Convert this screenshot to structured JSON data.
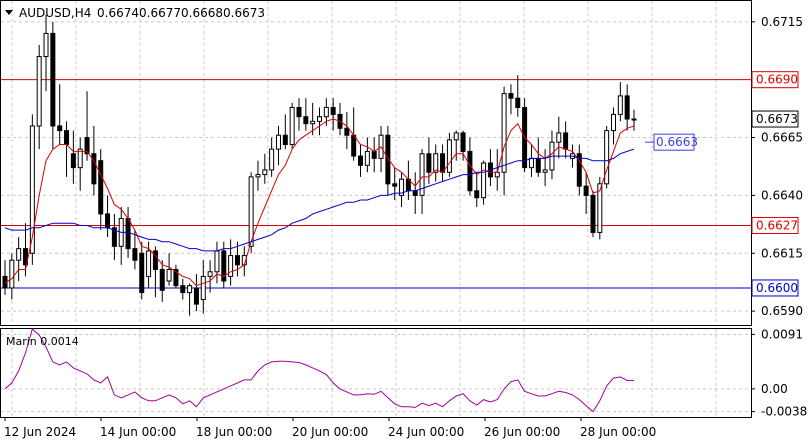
{
  "chart_data": {
    "type": "candlestick",
    "symbol_header": "AUDUSD,H4",
    "ohlc_header": [
      "0.6674",
      "0.6677",
      "0.6668",
      "0.6673"
    ],
    "x_tick_labels": [
      "12 Jun 2024",
      "14 Jun 00:00",
      "18 Jun 00:00",
      "20 Jun 00:00",
      "24 Jun 00:00",
      "26 Jun 00:00",
      "28 Jun 00:00"
    ],
    "price_ticks": [
      "0.6715",
      "0.6665",
      "0.6640",
      "0.6615",
      "0.6590"
    ],
    "price_ylim": [
      0.6584,
      0.6724
    ],
    "grid": true,
    "series": [
      {
        "name": "",
        "kind": "ohlc",
        "ohlc": [
          [
            0.6605,
            0.6612,
            0.6597,
            0.66
          ],
          [
            0.66,
            0.6615,
            0.6595,
            0.6612
          ],
          [
            0.6612,
            0.6622,
            0.6603,
            0.6617
          ],
          [
            0.6617,
            0.6628,
            0.6605,
            0.661
          ],
          [
            0.6615,
            0.6675,
            0.661,
            0.667
          ],
          [
            0.667,
            0.6705,
            0.666,
            0.67
          ],
          [
            0.67,
            0.6718,
            0.6685,
            0.671
          ],
          [
            0.671,
            0.6715,
            0.666,
            0.667
          ],
          [
            0.667,
            0.6688,
            0.6662,
            0.6668
          ],
          [
            0.6668,
            0.6672,
            0.6648,
            0.6662
          ],
          [
            0.6658,
            0.6668,
            0.6645,
            0.6652
          ],
          [
            0.6652,
            0.6665,
            0.6642,
            0.666
          ],
          [
            0.6665,
            0.6685,
            0.6655,
            0.6658
          ],
          [
            0.6658,
            0.667,
            0.664,
            0.6645
          ],
          [
            0.6655,
            0.666,
            0.6625,
            0.6632
          ],
          [
            0.6632,
            0.664,
            0.6622,
            0.6626
          ],
          [
            0.6626,
            0.6632,
            0.6612,
            0.6618
          ],
          [
            0.6618,
            0.6635,
            0.661,
            0.663
          ],
          [
            0.663,
            0.6635,
            0.6613,
            0.6617
          ],
          [
            0.6617,
            0.6625,
            0.6608,
            0.6612
          ],
          [
            0.6615,
            0.662,
            0.6595,
            0.6598
          ],
          [
            0.6605,
            0.662,
            0.66,
            0.6616
          ],
          [
            0.6616,
            0.6618,
            0.6596,
            0.6608
          ],
          [
            0.6608,
            0.6612,
            0.6594,
            0.6599
          ],
          [
            0.6603,
            0.6615,
            0.6601,
            0.6608
          ],
          [
            0.6608,
            0.661,
            0.66,
            0.6601
          ],
          [
            0.6601,
            0.6604,
            0.6595,
            0.6598
          ],
          [
            0.6598,
            0.6602,
            0.6588,
            0.6601
          ],
          [
            0.66,
            0.6606,
            0.659,
            0.6593
          ],
          [
            0.6595,
            0.6612,
            0.6589,
            0.6605
          ],
          [
            0.6605,
            0.6612,
            0.6598,
            0.6607
          ],
          [
            0.6607,
            0.662,
            0.6602,
            0.6616
          ],
          [
            0.6616,
            0.662,
            0.66,
            0.6603
          ],
          [
            0.6605,
            0.6621,
            0.6601,
            0.6614
          ],
          [
            0.6614,
            0.662,
            0.6605,
            0.661
          ],
          [
            0.661,
            0.6618,
            0.6605,
            0.6614
          ],
          [
            0.6618,
            0.665,
            0.6615,
            0.6648
          ],
          [
            0.6648,
            0.6655,
            0.6642,
            0.6649
          ],
          [
            0.6649,
            0.6658,
            0.6645,
            0.6651
          ],
          [
            0.6651,
            0.6665,
            0.6648,
            0.666
          ],
          [
            0.666,
            0.667,
            0.6653,
            0.6666
          ],
          [
            0.6666,
            0.6675,
            0.666,
            0.6662
          ],
          [
            0.6662,
            0.668,
            0.666,
            0.6678
          ],
          [
            0.6678,
            0.6682,
            0.6668,
            0.6674
          ],
          [
            0.6674,
            0.6682,
            0.6668,
            0.6671
          ],
          [
            0.6671,
            0.668,
            0.6666,
            0.6672
          ],
          [
            0.6672,
            0.6678,
            0.6666,
            0.6674
          ],
          [
            0.6674,
            0.6682,
            0.667,
            0.6678
          ],
          [
            0.6678,
            0.6682,
            0.6668,
            0.6675
          ],
          [
            0.6675,
            0.668,
            0.6666,
            0.6669
          ],
          [
            0.6669,
            0.6676,
            0.666,
            0.6666
          ],
          [
            0.6666,
            0.6678,
            0.6655,
            0.6657
          ],
          [
            0.6657,
            0.6662,
            0.6648,
            0.6653
          ],
          [
            0.6653,
            0.6665,
            0.665,
            0.6659
          ],
          [
            0.6659,
            0.6665,
            0.665,
            0.6656
          ],
          [
            0.6656,
            0.667,
            0.665,
            0.6666
          ],
          [
            0.6666,
            0.667,
            0.664,
            0.6645
          ],
          [
            0.6645,
            0.6652,
            0.6638,
            0.6644
          ],
          [
            0.664,
            0.665,
            0.6635,
            0.6647
          ],
          [
            0.6647,
            0.6655,
            0.6638,
            0.6642
          ],
          [
            0.6642,
            0.665,
            0.6632,
            0.664
          ],
          [
            0.664,
            0.666,
            0.6632,
            0.6658
          ],
          [
            0.6658,
            0.6665,
            0.6645,
            0.665
          ],
          [
            0.665,
            0.6662,
            0.6646,
            0.6658
          ],
          [
            0.6658,
            0.6662,
            0.6646,
            0.665
          ],
          [
            0.665,
            0.6667,
            0.6648,
            0.6664
          ],
          [
            0.6664,
            0.6668,
            0.6655,
            0.6667
          ],
          [
            0.6667,
            0.6668,
            0.6655,
            0.6659
          ],
          [
            0.6659,
            0.6665,
            0.664,
            0.6642
          ],
          [
            0.6642,
            0.665,
            0.6635,
            0.6639
          ],
          [
            0.6639,
            0.6655,
            0.6636,
            0.6654
          ],
          [
            0.6654,
            0.666,
            0.6644,
            0.6648
          ],
          [
            0.6648,
            0.666,
            0.6642,
            0.665
          ],
          [
            0.665,
            0.6687,
            0.664,
            0.6684
          ],
          [
            0.6684,
            0.6688,
            0.6675,
            0.6682
          ],
          [
            0.6682,
            0.6692,
            0.6674,
            0.6678
          ],
          [
            0.6678,
            0.6682,
            0.665,
            0.6652
          ],
          [
            0.6652,
            0.6662,
            0.6648,
            0.6656
          ],
          [
            0.6656,
            0.6665,
            0.6648,
            0.665
          ],
          [
            0.665,
            0.666,
            0.6644,
            0.6651
          ],
          [
            0.6651,
            0.6668,
            0.6647,
            0.6663
          ],
          [
            0.6663,
            0.6674,
            0.6656,
            0.6667
          ],
          [
            0.6667,
            0.6672,
            0.6656,
            0.666
          ],
          [
            0.6656,
            0.6662,
            0.6652,
            0.6658
          ],
          [
            0.6658,
            0.6662,
            0.664,
            0.6644
          ],
          [
            0.6644,
            0.665,
            0.6632,
            0.664
          ],
          [
            0.664,
            0.6642,
            0.6622,
            0.6624
          ],
          [
            0.6624,
            0.6648,
            0.6621,
            0.6645
          ],
          [
            0.6645,
            0.667,
            0.6643,
            0.6668
          ],
          [
            0.6668,
            0.6678,
            0.6662,
            0.6675
          ],
          [
            0.6675,
            0.6689,
            0.6672,
            0.6683
          ],
          [
            0.6683,
            0.6688,
            0.6668,
            0.6673
          ],
          [
            0.6673,
            0.6677,
            0.6668,
            0.6673
          ]
        ]
      },
      {
        "name": "",
        "kind": "line",
        "color": "#dc0000",
        "values": [
          0.6602,
          0.6604,
          0.6608,
          0.6608,
          0.6622,
          0.664,
          0.6655,
          0.666,
          0.6662,
          0.6662,
          0.6659,
          0.6659,
          0.6659,
          0.6655,
          0.6649,
          0.6643,
          0.6636,
          0.6634,
          0.663,
          0.6625,
          0.6618,
          0.6617,
          0.6614,
          0.661,
          0.6609,
          0.6607,
          0.6605,
          0.6604,
          0.6601,
          0.6602,
          0.6603,
          0.6606,
          0.6605,
          0.6607,
          0.6608,
          0.661,
          0.662,
          0.6628,
          0.6635,
          0.6642,
          0.6649,
          0.6653,
          0.666,
          0.6664,
          0.6666,
          0.6668,
          0.667,
          0.6672,
          0.6673,
          0.6672,
          0.667,
          0.6666,
          0.6662,
          0.6661,
          0.6659,
          0.6661,
          0.6656,
          0.6652,
          0.665,
          0.6647,
          0.6644,
          0.6648,
          0.6648,
          0.6651,
          0.665,
          0.6654,
          0.6658,
          0.6658,
          0.6653,
          0.6649,
          0.6651,
          0.665,
          0.665,
          0.6661,
          0.6668,
          0.6671,
          0.6665,
          0.6662,
          0.6658,
          0.6656,
          0.6658,
          0.6661,
          0.666,
          0.6659,
          0.6655,
          0.665,
          0.6641,
          0.6642,
          0.6651,
          0.6659,
          0.6667,
          0.6669,
          0.667
        ]
      },
      {
        "name": "",
        "kind": "line",
        "color": "#0000c8",
        "values": [
          0.6626,
          0.6625,
          0.6625,
          0.6625,
          0.6626,
          0.6626,
          0.6627,
          0.6628,
          0.6628,
          0.6628,
          0.6628,
          0.6627,
          0.6627,
          0.6626,
          0.6626,
          0.6626,
          0.6625,
          0.6624,
          0.6624,
          0.6623,
          0.6622,
          0.6621,
          0.6621,
          0.662,
          0.662,
          0.6619,
          0.6618,
          0.6617,
          0.6617,
          0.6616,
          0.6616,
          0.6616,
          0.6617,
          0.6617,
          0.6618,
          0.6619,
          0.662,
          0.6621,
          0.6622,
          0.6623,
          0.6625,
          0.6626,
          0.6628,
          0.6629,
          0.663,
          0.6632,
          0.6633,
          0.6634,
          0.6635,
          0.6636,
          0.6637,
          0.6637,
          0.6638,
          0.6638,
          0.6639,
          0.664,
          0.664,
          0.6641,
          0.6641,
          0.6642,
          0.6642,
          0.6643,
          0.6644,
          0.6645,
          0.6646,
          0.6647,
          0.6648,
          0.6649,
          0.6649,
          0.665,
          0.665,
          0.6651,
          0.6652,
          0.6653,
          0.6654,
          0.6655,
          0.6655,
          0.6656,
          0.6656,
          0.6656,
          0.6657,
          0.6657,
          0.6657,
          0.6657,
          0.6656,
          0.6656,
          0.6655,
          0.6655,
          0.6655,
          0.6656,
          0.6658,
          0.6659,
          0.666
        ]
      }
    ],
    "horizontal_levels": [
      {
        "value": 0.669,
        "label": "0.6690",
        "color": "#dc0000"
      },
      {
        "value": 0.6627,
        "label": "0.6627",
        "color": "#dc0000"
      },
      {
        "value": 0.66,
        "label": "0.6600",
        "color": "#0000c8"
      }
    ],
    "current_price": {
      "value": 0.6673,
      "label": "0.6673"
    },
    "ma_callout": {
      "value": 0.6663,
      "label": "0.6663"
    },
    "indicator": {
      "title": "Marin 0.0014",
      "ticks": [
        "0.0091",
        "0.00",
        "-0.0038"
      ],
      "ylim": [
        -0.0047,
        0.01
      ],
      "values": [
        0.0,
        0.001,
        0.003,
        0.006,
        0.01,
        0.009,
        0.007,
        0.0045,
        0.004,
        0.0045,
        0.0035,
        0.003,
        0.0025,
        0.0015,
        0.001,
        0.002,
        -0.001,
        -0.0015,
        -0.001,
        -0.0005,
        -0.0015,
        -0.002,
        -0.002,
        -0.0015,
        -0.001,
        -0.0015,
        -0.0025,
        -0.002,
        -0.003,
        -0.0015,
        -0.001,
        -0.0005,
        0.0,
        0.0005,
        0.001,
        0.0015,
        0.0015,
        0.003,
        0.004,
        0.0045,
        0.0046,
        0.0046,
        0.0045,
        0.0044,
        0.004,
        0.0035,
        0.003,
        0.0024,
        0.001,
        0.0,
        -0.0005,
        -0.001,
        -0.001,
        -0.0008,
        -0.0009,
        -0.0004,
        -0.0015,
        -0.0025,
        -0.003,
        -0.003,
        -0.0031,
        -0.0024,
        -0.0028,
        -0.0024,
        -0.003,
        -0.002,
        -0.0012,
        -0.0008,
        -0.002,
        -0.0027,
        -0.0018,
        -0.0022,
        -0.0018,
        0.0,
        0.0012,
        0.0015,
        -0.0004,
        -0.0008,
        -0.0012,
        -0.0012,
        -0.0008,
        -0.0004,
        -0.0006,
        -0.001,
        -0.0018,
        -0.0028,
        -0.0038,
        -0.002,
        0.0005,
        0.0018,
        0.002,
        0.0014,
        0.0014
      ]
    }
  }
}
